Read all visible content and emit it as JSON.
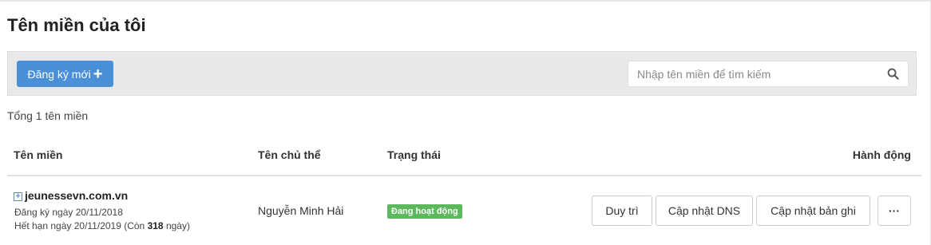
{
  "page": {
    "title": "Tên miền của tôi"
  },
  "toolbar": {
    "register_label": "Đăng ký mới",
    "search_placeholder": "Nhập tên miền để tìm kiếm"
  },
  "summary": {
    "total_text": "Tổng 1 tên miền"
  },
  "table": {
    "headers": {
      "domain": "Tên miền",
      "owner": "Tên chủ thể",
      "status": "Trạng thái",
      "actions": "Hành động"
    },
    "rows": [
      {
        "domain": "jeunessevn.com.vn",
        "registered_text": "Đăng ký ngày 20/11/2018",
        "expiry_prefix": "Hết hạn ngày 20/11/2019 (Còn ",
        "days_left": "318",
        "expiry_suffix": " ngày)",
        "owner": "Nguyễn Minh Hải",
        "status": "Đang hoạt động",
        "actions": {
          "renew": "Duy trì",
          "update_dns": "Cập nhật DNS",
          "update_record": "Cập nhật bản ghi",
          "more": "···"
        }
      }
    ]
  },
  "colors": {
    "primary": "#4a90d9",
    "status_active": "#5cb85c",
    "toolbar_bg": "#e9e9e9"
  },
  "icons": {
    "search": "search-icon",
    "plus": "plus-icon",
    "expand": "expand-icon"
  }
}
